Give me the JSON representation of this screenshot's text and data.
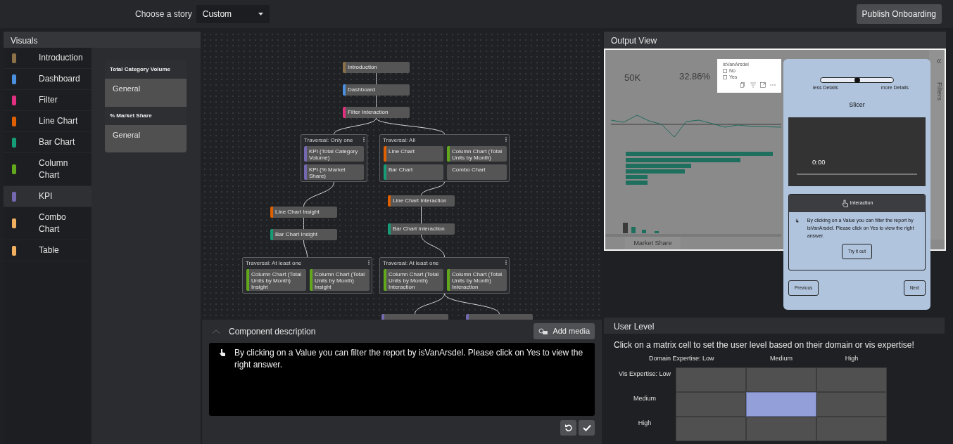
{
  "top_bar": {
    "story_label": "Choose a story",
    "story_value": "Custom",
    "publish_button": "Publish Onboarding"
  },
  "visuals": {
    "title": "Visuals",
    "items": [
      {
        "label": "Introduction",
        "color": "#8d7148",
        "selected": false
      },
      {
        "label": "Dashboard",
        "color": "#4a8fe0",
        "selected": false
      },
      {
        "label": "Filter",
        "color": "#e0307f",
        "selected": false
      },
      {
        "label": "Line Chart",
        "color": "#e06000",
        "selected": false
      },
      {
        "label": "Bar Chart",
        "color": "#169c76",
        "selected": false
      },
      {
        "label": "Column Chart",
        "color": "#62a81d",
        "selected": false
      },
      {
        "label": "KPI",
        "color": "#7468b0",
        "selected": true
      },
      {
        "label": "Combo Chart",
        "color": "#f0b060",
        "selected": false
      },
      {
        "label": "Table",
        "color": "#f0b060",
        "selected": false
      }
    ],
    "details": [
      {
        "title": "Total Category Volume",
        "value": "General"
      },
      {
        "title": "% Market Share",
        "value": "General"
      }
    ]
  },
  "graph": {
    "items": [
      {
        "kind": "node",
        "label": "Introduction",
        "color": "#8d7148"
      },
      {
        "kind": "node",
        "label": "Dashboard",
        "color": "#4a8fe0"
      },
      {
        "kind": "node",
        "label": "Filter Interaction",
        "color": "#e0307f"
      },
      {
        "kind": "group",
        "title": "Traversal: Only one",
        "children": [
          {
            "label": "KPI (Total Category Volume)",
            "color": "#7468b0"
          },
          {
            "label": "KPI (% Market Share)",
            "color": "#7468b0"
          }
        ]
      },
      {
        "kind": "group",
        "title": "Traversal: All",
        "children": [
          {
            "label": "Line Chart",
            "color": "#e06000"
          },
          {
            "label": "Column Chart (Total Units by Month)",
            "color": "#62a81d"
          },
          {
            "label": "Bar Chart",
            "color": "#169c76"
          },
          {
            "label": "Combo Chart"
          }
        ]
      },
      {
        "kind": "node",
        "label": "Line Chart Insight",
        "color": "#e06000"
      },
      {
        "kind": "node",
        "label": "Bar Chart Insight",
        "color": "#169c76"
      },
      {
        "kind": "node",
        "label": "Line Chart Interaction",
        "color": "#e06000"
      },
      {
        "kind": "node",
        "label": "Bar Chart Interaction",
        "color": "#169c76"
      },
      {
        "kind": "group",
        "title": "Traversal: At least one",
        "children": [
          {
            "label": "Column Chart (Total Units by Month) Insight",
            "color": "#62a81d"
          },
          {
            "label": "Column Chart (Total Units by Month) Insight",
            "color": "#62a81d"
          }
        ]
      },
      {
        "kind": "group",
        "title": "Traversal: At least one",
        "children": [
          {
            "label": "Column Chart (Total Units by Month) Interaction",
            "color": "#62a81d"
          },
          {
            "label": "Column Chart (Total Units by Month) Interaction",
            "color": "#62a81d"
          }
        ]
      },
      {
        "kind": "node",
        "color": "#7468b0"
      },
      {
        "kind": "node",
        "color": "#7468b0"
      }
    ]
  },
  "description": {
    "title": "Component description",
    "add_media_button": "Add media",
    "text": "By clicking on a Value you can filter the report by isVanArsdel. Please click on Yes to view the right answer."
  },
  "output_view": {
    "title": "Output View",
    "report": {
      "kpi_values": [
        "50K",
        "32.86%"
      ],
      "slicer": {
        "title": "isVanArsdel",
        "options": [
          {
            "label": "No",
            "checked": false
          },
          {
            "label": "Yes",
            "checked": false
          }
        ]
      },
      "page_tab": "Market Share",
      "filters_label": "Filters"
    },
    "popup": {
      "slider": {
        "level": 0.5,
        "min_label": "less Details",
        "max_label": "more Details"
      },
      "component_title": "Slicer",
      "video_time": "0:00",
      "card_title": "Interaction",
      "card_text": "By clicking on a Value you can filter the report by isVanArsdel. Please click on Yes to view the right answer.",
      "try_button": "Try it out",
      "previous_button": "Previous",
      "next_button": "Next"
    }
  },
  "user_level": {
    "title": "User Level",
    "instruction": "Click on a matrix cell to set the user level based on their domain or vis expertise!",
    "column_labels": [
      "Domain Expertise: Low",
      "Medium",
      "High"
    ],
    "row_labels": [
      "Vis Expertise: Low",
      "Medium",
      "High"
    ],
    "cells": [
      [
        {
          "selected": false
        },
        {
          "selected": false
        },
        {
          "selected": false
        }
      ],
      [
        {
          "selected": false
        },
        {
          "selected": true
        },
        {
          "selected": false
        }
      ],
      [
        {
          "selected": false
        },
        {
          "selected": false
        },
        {
          "selected": false
        }
      ]
    ]
  }
}
